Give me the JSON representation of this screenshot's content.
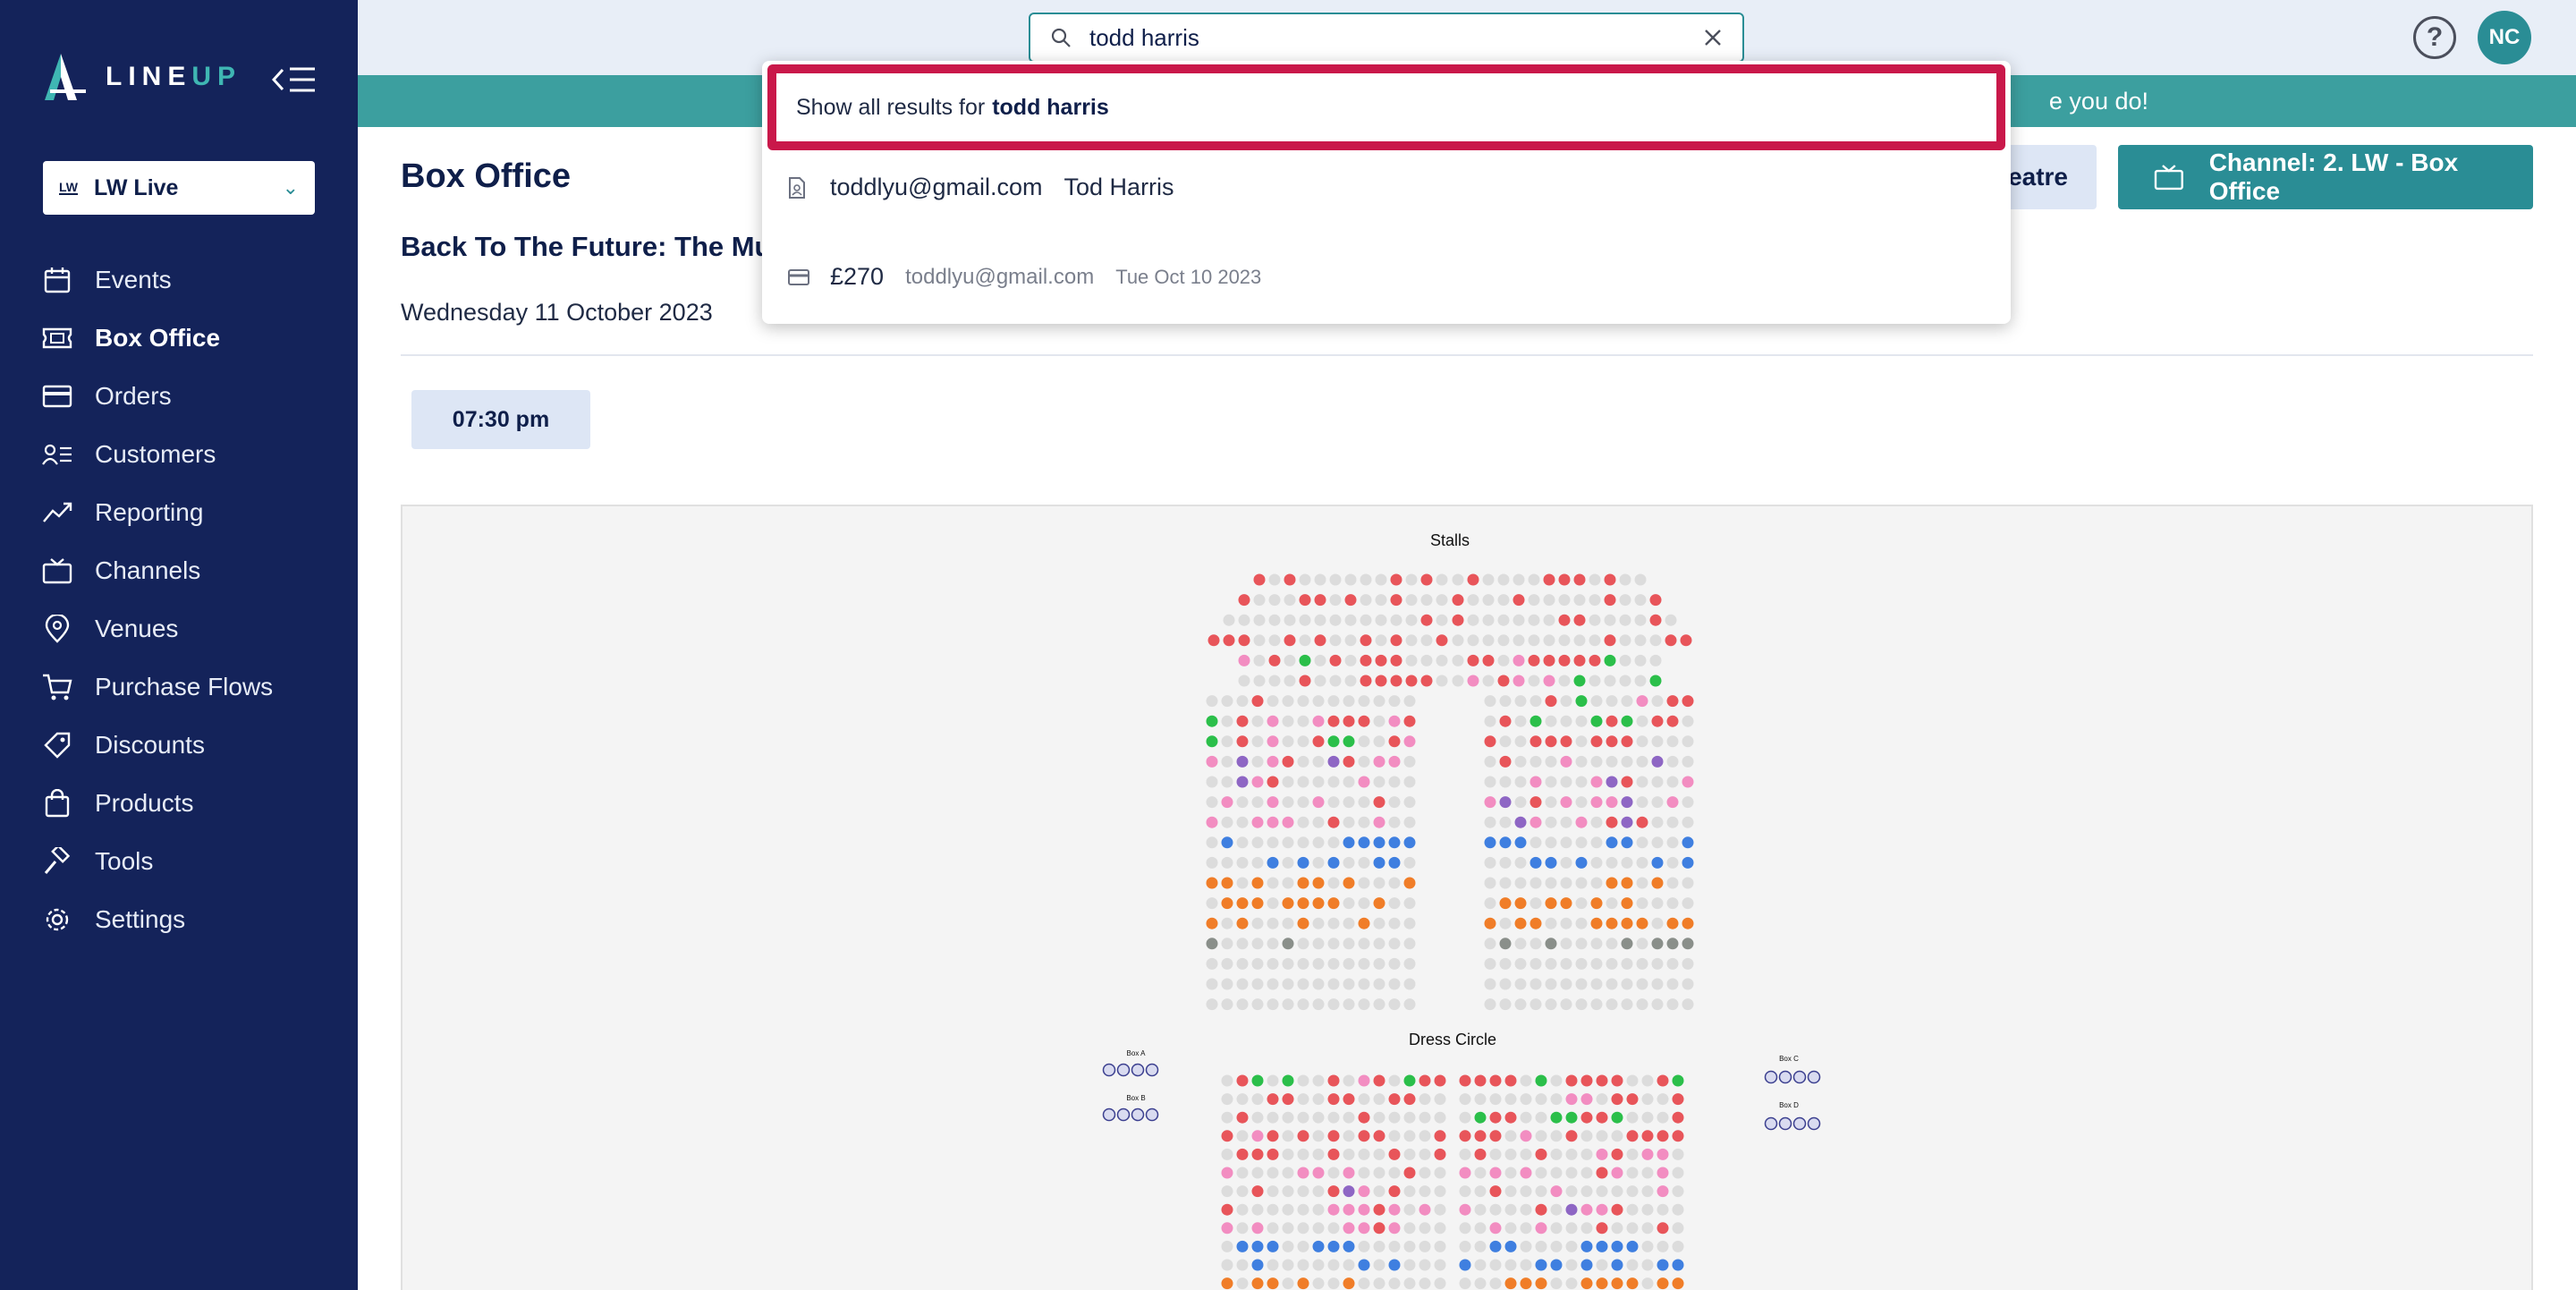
{
  "sidebar": {
    "logo_text_line": "LINE",
    "logo_text_up": "UP",
    "org": {
      "logo": "LW",
      "name": "LW Live"
    },
    "items": [
      {
        "label": "Events",
        "icon": "calendar-icon"
      },
      {
        "label": "Box Office",
        "icon": "ticket-icon",
        "active": true
      },
      {
        "label": "Orders",
        "icon": "credit-card-icon"
      },
      {
        "label": "Customers",
        "icon": "customers-icon"
      },
      {
        "label": "Reporting",
        "icon": "chart-line-icon"
      },
      {
        "label": "Channels",
        "icon": "tv-icon"
      },
      {
        "label": "Venues",
        "icon": "map-pin-icon"
      },
      {
        "label": "Purchase Flows",
        "icon": "cart-icon"
      },
      {
        "label": "Discounts",
        "icon": "tag-icon"
      },
      {
        "label": "Products",
        "icon": "shopping-bag-icon"
      },
      {
        "label": "Tools",
        "icon": "hammer-icon"
      },
      {
        "label": "Settings",
        "icon": "gear-icon"
      }
    ]
  },
  "topbar": {
    "search_value": "todd harris",
    "avatar_initials": "NC",
    "help_glyph": "?"
  },
  "banner": {
    "text": "e you do!"
  },
  "main": {
    "page_title": "Box Office",
    "event_title": "Back To The Future: The Mu",
    "event_date": "Wednesday 11 October 2023",
    "venue_button": "eatre",
    "channel_button": "Channel: 2. LW - Box Office",
    "time_slot": "07:30 pm"
  },
  "search_dropdown": {
    "show_all_prefix": "Show all results for",
    "show_all_query": "todd harris",
    "customer_result": {
      "email": "toddlyu@gmail.com",
      "name": "Tod Harris"
    },
    "order_result": {
      "amount": "£270",
      "email": "toddlyu@gmail.com",
      "date": "Tue Oct 10 2023"
    }
  },
  "seatmap": {
    "stalls_label": "Stalls",
    "dress_circle_label": "Dress Circle",
    "box_labels": [
      "Box A",
      "Box B",
      "Box C",
      "Box D"
    ],
    "colors": {
      "available": "#dcdcdc",
      "red": "#e8555a",
      "pink": "#f28dc1",
      "purple": "#8e66c4",
      "blue": "#3f7fe0",
      "orange": "#f07d28",
      "green": "#2bbf4a",
      "grey": "#8a8f8a",
      "navy": "#3b3f8f"
    }
  },
  "colors": {
    "sidebar": "#14235a",
    "accent": "#2a8d95",
    "highlight": "#c9184a"
  }
}
